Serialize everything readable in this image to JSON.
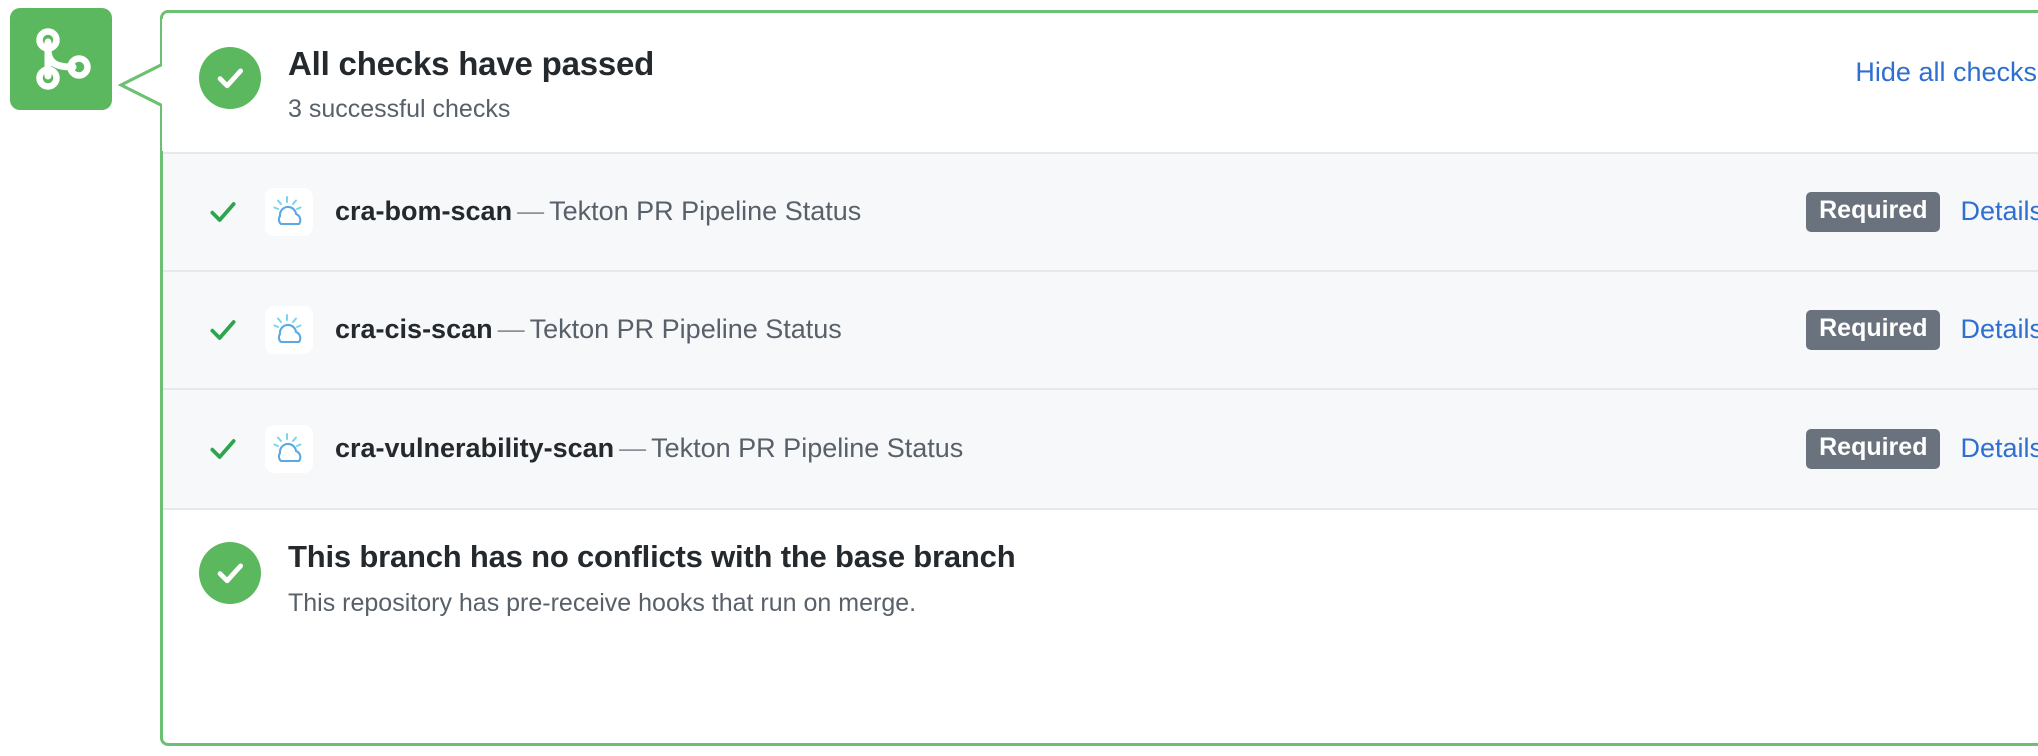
{
  "badge": {
    "icon": "git-merge-icon",
    "color": "#5cb85f"
  },
  "panel": {
    "border_color": "#6cc071"
  },
  "header": {
    "status_icon": "check-circle-icon",
    "title": "All checks have passed",
    "subtitle": "3 successful checks",
    "hide_all_label": "Hide all checks",
    "link_color": "#2f6fd0"
  },
  "checks": [
    {
      "status_icon": "check-icon",
      "app_icon": "ibm-cloud-icon",
      "context": "cra-bom-scan",
      "dash": "—",
      "description": "Tekton PR Pipeline Status",
      "required_label": "Required",
      "details_label": "Details"
    },
    {
      "status_icon": "check-icon",
      "app_icon": "ibm-cloud-icon",
      "context": "cra-cis-scan",
      "dash": "—",
      "description": "Tekton PR Pipeline Status",
      "required_label": "Required",
      "details_label": "Details"
    },
    {
      "status_icon": "check-icon",
      "app_icon": "ibm-cloud-icon",
      "context": "cra-vulnerability-scan",
      "dash": "—",
      "description": "Tekton PR Pipeline Status",
      "required_label": "Required",
      "details_label": "Details"
    }
  ],
  "conflicts": {
    "status_icon": "check-circle-icon",
    "title": "This branch has no conflicts with the base branch",
    "subtitle": "This repository has pre-receive hooks that run on merge."
  }
}
